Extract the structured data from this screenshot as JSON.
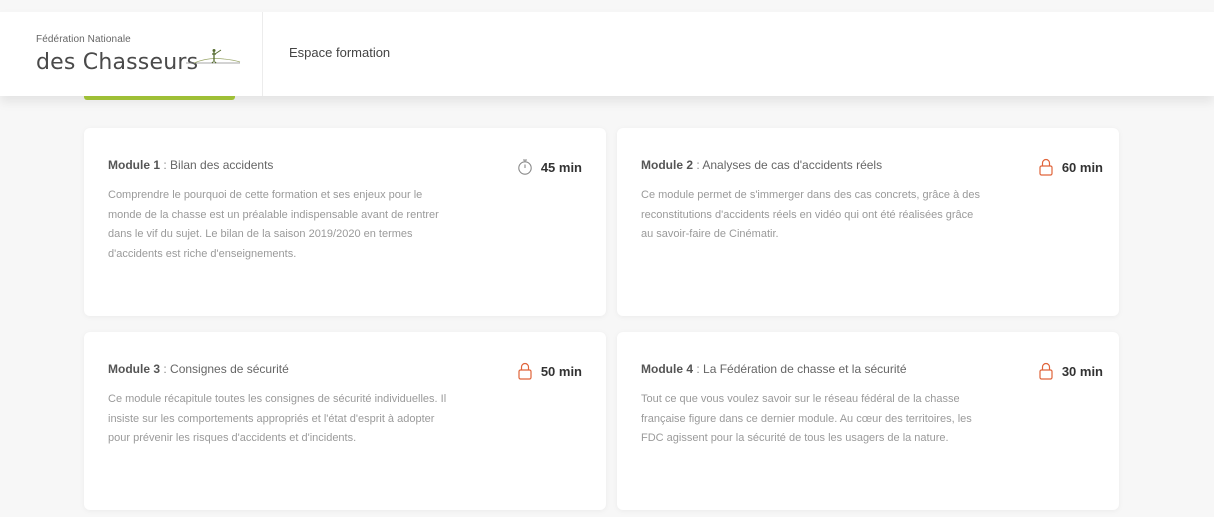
{
  "header": {
    "logo": {
      "line1": "Fédération Nationale",
      "line2": "des Chasseurs"
    },
    "nav_title": "Espace formation"
  },
  "colors": {
    "accent_green": "#a9cc3a",
    "lock_orange": "#e0643a",
    "timer_gray": "#8a8a8a"
  },
  "modules": [
    {
      "label": "Module 1",
      "separator": " : ",
      "title": "Bilan des accidents",
      "duration": "45 min",
      "icon": "timer-icon",
      "description": "Comprendre le pourquoi de cette formation et ses enjeux pour le monde de la chasse est un préalable indispensable avant de rentrer dans le vif du sujet. Le bilan de la saison 2019/2020 en termes d'accidents est riche d'enseignements."
    },
    {
      "label": "Module 2",
      "separator": " : ",
      "title": "Analyses de cas d'accidents réels",
      "duration": "60 min",
      "icon": "lock-icon",
      "description": "Ce module permet de s'immerger dans des cas concrets, grâce à des reconstitutions d'accidents réels en vidéo qui ont été réalisées grâce au savoir-faire de Cinématir."
    },
    {
      "label": "Module 3",
      "separator": " : ",
      "title": "Consignes de sécurité",
      "duration": "50 min",
      "icon": "lock-icon",
      "description": "Ce module récapitule toutes les consignes de sécurité individuelles. Il insiste sur les comportements appropriés et l'état d'esprit à adopter pour prévenir les risques d'accidents et d'incidents."
    },
    {
      "label": "Module 4",
      "separator": " : ",
      "title": "La Fédération de chasse et la sécurité",
      "duration": "30 min",
      "icon": "lock-icon",
      "description": "Tout ce que vous voulez savoir sur le réseau fédéral de la chasse française figure dans ce dernier module. Au cœur des territoires, les FDC agissent pour la sécurité de tous les usagers de la nature."
    }
  ]
}
